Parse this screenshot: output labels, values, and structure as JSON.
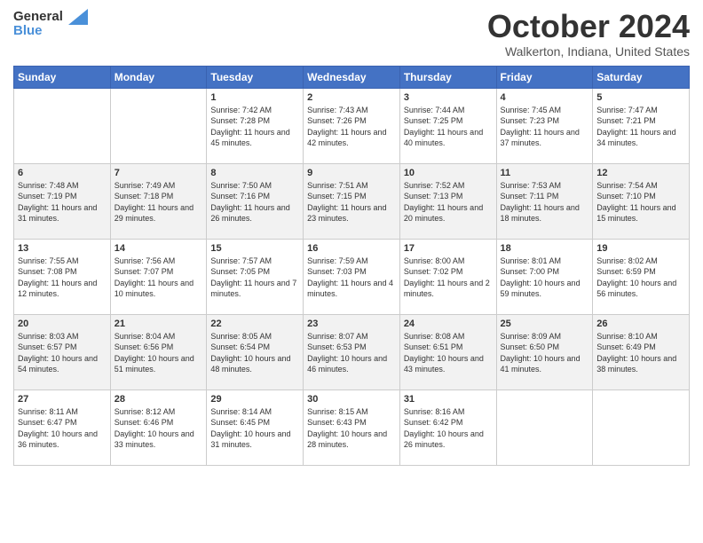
{
  "header": {
    "logo_line1": "General",
    "logo_line2": "Blue",
    "month": "October 2024",
    "location": "Walkerton, Indiana, United States"
  },
  "weekdays": [
    "Sunday",
    "Monday",
    "Tuesday",
    "Wednesday",
    "Thursday",
    "Friday",
    "Saturday"
  ],
  "weeks": [
    [
      {
        "day": "",
        "sunrise": "",
        "sunset": "",
        "daylight": ""
      },
      {
        "day": "",
        "sunrise": "",
        "sunset": "",
        "daylight": ""
      },
      {
        "day": "1",
        "sunrise": "Sunrise: 7:42 AM",
        "sunset": "Sunset: 7:28 PM",
        "daylight": "Daylight: 11 hours and 45 minutes."
      },
      {
        "day": "2",
        "sunrise": "Sunrise: 7:43 AM",
        "sunset": "Sunset: 7:26 PM",
        "daylight": "Daylight: 11 hours and 42 minutes."
      },
      {
        "day": "3",
        "sunrise": "Sunrise: 7:44 AM",
        "sunset": "Sunset: 7:25 PM",
        "daylight": "Daylight: 11 hours and 40 minutes."
      },
      {
        "day": "4",
        "sunrise": "Sunrise: 7:45 AM",
        "sunset": "Sunset: 7:23 PM",
        "daylight": "Daylight: 11 hours and 37 minutes."
      },
      {
        "day": "5",
        "sunrise": "Sunrise: 7:47 AM",
        "sunset": "Sunset: 7:21 PM",
        "daylight": "Daylight: 11 hours and 34 minutes."
      }
    ],
    [
      {
        "day": "6",
        "sunrise": "Sunrise: 7:48 AM",
        "sunset": "Sunset: 7:19 PM",
        "daylight": "Daylight: 11 hours and 31 minutes."
      },
      {
        "day": "7",
        "sunrise": "Sunrise: 7:49 AM",
        "sunset": "Sunset: 7:18 PM",
        "daylight": "Daylight: 11 hours and 29 minutes."
      },
      {
        "day": "8",
        "sunrise": "Sunrise: 7:50 AM",
        "sunset": "Sunset: 7:16 PM",
        "daylight": "Daylight: 11 hours and 26 minutes."
      },
      {
        "day": "9",
        "sunrise": "Sunrise: 7:51 AM",
        "sunset": "Sunset: 7:15 PM",
        "daylight": "Daylight: 11 hours and 23 minutes."
      },
      {
        "day": "10",
        "sunrise": "Sunrise: 7:52 AM",
        "sunset": "Sunset: 7:13 PM",
        "daylight": "Daylight: 11 hours and 20 minutes."
      },
      {
        "day": "11",
        "sunrise": "Sunrise: 7:53 AM",
        "sunset": "Sunset: 7:11 PM",
        "daylight": "Daylight: 11 hours and 18 minutes."
      },
      {
        "day": "12",
        "sunrise": "Sunrise: 7:54 AM",
        "sunset": "Sunset: 7:10 PM",
        "daylight": "Daylight: 11 hours and 15 minutes."
      }
    ],
    [
      {
        "day": "13",
        "sunrise": "Sunrise: 7:55 AM",
        "sunset": "Sunset: 7:08 PM",
        "daylight": "Daylight: 11 hours and 12 minutes."
      },
      {
        "day": "14",
        "sunrise": "Sunrise: 7:56 AM",
        "sunset": "Sunset: 7:07 PM",
        "daylight": "Daylight: 11 hours and 10 minutes."
      },
      {
        "day": "15",
        "sunrise": "Sunrise: 7:57 AM",
        "sunset": "Sunset: 7:05 PM",
        "daylight": "Daylight: 11 hours and 7 minutes."
      },
      {
        "day": "16",
        "sunrise": "Sunrise: 7:59 AM",
        "sunset": "Sunset: 7:03 PM",
        "daylight": "Daylight: 11 hours and 4 minutes."
      },
      {
        "day": "17",
        "sunrise": "Sunrise: 8:00 AM",
        "sunset": "Sunset: 7:02 PM",
        "daylight": "Daylight: 11 hours and 2 minutes."
      },
      {
        "day": "18",
        "sunrise": "Sunrise: 8:01 AM",
        "sunset": "Sunset: 7:00 PM",
        "daylight": "Daylight: 10 hours and 59 minutes."
      },
      {
        "day": "19",
        "sunrise": "Sunrise: 8:02 AM",
        "sunset": "Sunset: 6:59 PM",
        "daylight": "Daylight: 10 hours and 56 minutes."
      }
    ],
    [
      {
        "day": "20",
        "sunrise": "Sunrise: 8:03 AM",
        "sunset": "Sunset: 6:57 PM",
        "daylight": "Daylight: 10 hours and 54 minutes."
      },
      {
        "day": "21",
        "sunrise": "Sunrise: 8:04 AM",
        "sunset": "Sunset: 6:56 PM",
        "daylight": "Daylight: 10 hours and 51 minutes."
      },
      {
        "day": "22",
        "sunrise": "Sunrise: 8:05 AM",
        "sunset": "Sunset: 6:54 PM",
        "daylight": "Daylight: 10 hours and 48 minutes."
      },
      {
        "day": "23",
        "sunrise": "Sunrise: 8:07 AM",
        "sunset": "Sunset: 6:53 PM",
        "daylight": "Daylight: 10 hours and 46 minutes."
      },
      {
        "day": "24",
        "sunrise": "Sunrise: 8:08 AM",
        "sunset": "Sunset: 6:51 PM",
        "daylight": "Daylight: 10 hours and 43 minutes."
      },
      {
        "day": "25",
        "sunrise": "Sunrise: 8:09 AM",
        "sunset": "Sunset: 6:50 PM",
        "daylight": "Daylight: 10 hours and 41 minutes."
      },
      {
        "day": "26",
        "sunrise": "Sunrise: 8:10 AM",
        "sunset": "Sunset: 6:49 PM",
        "daylight": "Daylight: 10 hours and 38 minutes."
      }
    ],
    [
      {
        "day": "27",
        "sunrise": "Sunrise: 8:11 AM",
        "sunset": "Sunset: 6:47 PM",
        "daylight": "Daylight: 10 hours and 36 minutes."
      },
      {
        "day": "28",
        "sunrise": "Sunrise: 8:12 AM",
        "sunset": "Sunset: 6:46 PM",
        "daylight": "Daylight: 10 hours and 33 minutes."
      },
      {
        "day": "29",
        "sunrise": "Sunrise: 8:14 AM",
        "sunset": "Sunset: 6:45 PM",
        "daylight": "Daylight: 10 hours and 31 minutes."
      },
      {
        "day": "30",
        "sunrise": "Sunrise: 8:15 AM",
        "sunset": "Sunset: 6:43 PM",
        "daylight": "Daylight: 10 hours and 28 minutes."
      },
      {
        "day": "31",
        "sunrise": "Sunrise: 8:16 AM",
        "sunset": "Sunset: 6:42 PM",
        "daylight": "Daylight: 10 hours and 26 minutes."
      },
      {
        "day": "",
        "sunrise": "",
        "sunset": "",
        "daylight": ""
      },
      {
        "day": "",
        "sunrise": "",
        "sunset": "",
        "daylight": ""
      }
    ]
  ]
}
